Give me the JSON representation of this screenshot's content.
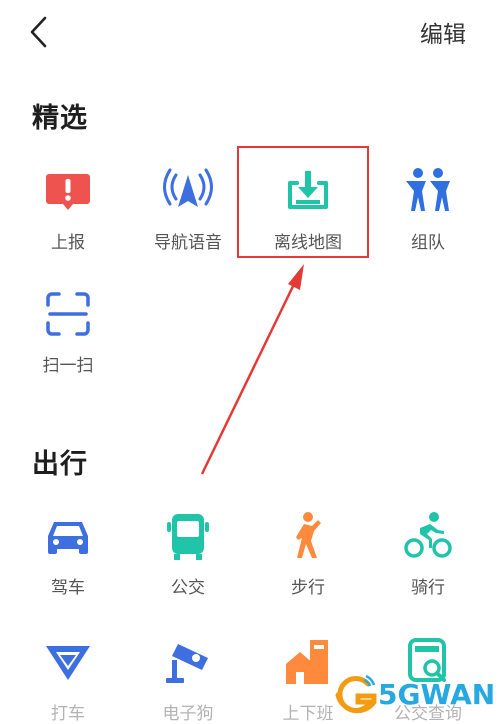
{
  "header": {
    "back_icon": "chevron-left-icon",
    "edit_label": "编辑"
  },
  "sections": {
    "featured": {
      "title": "精选",
      "items": [
        {
          "label": "上报",
          "icon": "report-alert-icon",
          "color": "#ef5350"
        },
        {
          "label": "导航语音",
          "icon": "navigation-voice-icon",
          "color": "#3d6fe0"
        },
        {
          "label": "离线地图",
          "icon": "offline-map-download-icon",
          "color": "#20c4a8"
        },
        {
          "label": "组队",
          "icon": "team-icon",
          "color": "#2f6fe0"
        },
        {
          "label": "扫一扫",
          "icon": "scan-icon",
          "color": "#3d6fe0"
        }
      ]
    },
    "travel": {
      "title": "出行",
      "items": [
        {
          "label": "驾车",
          "icon": "car-icon",
          "color": "#3d6fe0"
        },
        {
          "label": "公交",
          "icon": "bus-icon",
          "color": "#20c4a8"
        },
        {
          "label": "步行",
          "icon": "walk-icon",
          "color": "#ff8a3d"
        },
        {
          "label": "骑行",
          "icon": "cycling-icon",
          "color": "#20c4a8"
        },
        {
          "label": "打车",
          "icon": "taxi-icon",
          "color": "#3d6fe0"
        },
        {
          "label": "电子狗",
          "icon": "speed-camera-icon",
          "color": "#3d6fe0"
        },
        {
          "label": "上下班",
          "icon": "commute-icon",
          "color": "#ff8a3d"
        },
        {
          "label": "公交查询",
          "icon": "bus-search-icon",
          "color": "#20c4a8"
        }
      ]
    }
  },
  "annotation": {
    "color": "#e53935"
  },
  "watermark": {
    "text": "5GWAN",
    "color": "#27a8e0"
  }
}
